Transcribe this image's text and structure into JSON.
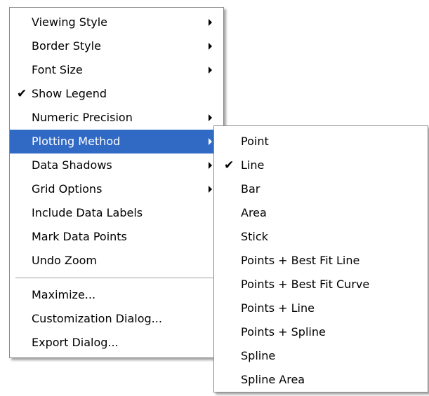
{
  "main_menu": {
    "items": [
      {
        "label": "Viewing Style",
        "submenu": true,
        "checked": false
      },
      {
        "label": "Border Style",
        "submenu": true,
        "checked": false
      },
      {
        "label": "Font Size",
        "submenu": true,
        "checked": false
      },
      {
        "label": "Show Legend",
        "submenu": false,
        "checked": true
      },
      {
        "label": "Numeric Precision",
        "submenu": true,
        "checked": false
      },
      {
        "label": "Plotting Method",
        "submenu": true,
        "checked": false,
        "highlighted": true
      },
      {
        "label": "Data Shadows",
        "submenu": true,
        "checked": false
      },
      {
        "label": "Grid Options",
        "submenu": true,
        "checked": false
      },
      {
        "label": "Include Data Labels",
        "submenu": false,
        "checked": false
      },
      {
        "label": "Mark Data Points",
        "submenu": false,
        "checked": false
      },
      {
        "label": "Undo Zoom",
        "submenu": false,
        "checked": false
      }
    ],
    "dialog_items": [
      {
        "label": "Maximize..."
      },
      {
        "label": "Customization Dialog..."
      },
      {
        "label": "Export Dialog..."
      }
    ]
  },
  "plotting_submenu": {
    "items": [
      {
        "label": "Point",
        "checked": false
      },
      {
        "label": "Line",
        "checked": true
      },
      {
        "label": "Bar",
        "checked": false
      },
      {
        "label": "Area",
        "checked": false
      },
      {
        "label": "Stick",
        "checked": false
      },
      {
        "label": "Points + Best Fit Line",
        "checked": false
      },
      {
        "label": "Points + Best Fit Curve",
        "checked": false
      },
      {
        "label": "Points + Line",
        "checked": false
      },
      {
        "label": "Points + Spline",
        "checked": false
      },
      {
        "label": "Spline",
        "checked": false
      },
      {
        "label": "Spline Area",
        "checked": false
      }
    ]
  },
  "glyphs": {
    "checkmark": "✔"
  },
  "colors": {
    "highlight": "#316ac5",
    "highlight_text": "#ffffff"
  }
}
